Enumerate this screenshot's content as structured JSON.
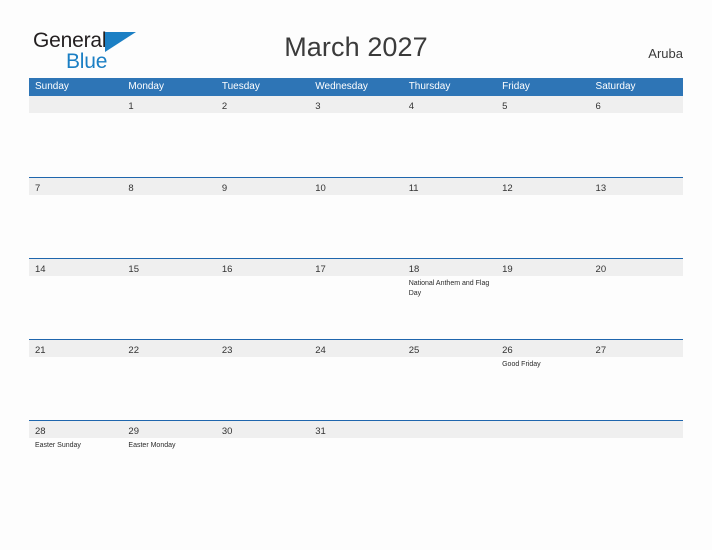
{
  "brand": {
    "name_part1": "General",
    "name_part2": "Blue",
    "flag_color": "#1b7fc4"
  },
  "header": {
    "title": "March 2027",
    "country": "Aruba"
  },
  "theme": {
    "header_blue": "#2e75b6",
    "row_line_blue": "#1f66ad",
    "number_band_gray": "#efefef",
    "page_background": "#fdfdfd"
  },
  "calendar": {
    "day_names": [
      "Sunday",
      "Monday",
      "Tuesday",
      "Wednesday",
      "Thursday",
      "Friday",
      "Saturday"
    ],
    "weeks": [
      [
        {
          "day": "",
          "events": []
        },
        {
          "day": "1",
          "events": []
        },
        {
          "day": "2",
          "events": []
        },
        {
          "day": "3",
          "events": []
        },
        {
          "day": "4",
          "events": []
        },
        {
          "day": "5",
          "events": []
        },
        {
          "day": "6",
          "events": []
        }
      ],
      [
        {
          "day": "7",
          "events": []
        },
        {
          "day": "8",
          "events": []
        },
        {
          "day": "9",
          "events": []
        },
        {
          "day": "10",
          "events": []
        },
        {
          "day": "11",
          "events": []
        },
        {
          "day": "12",
          "events": []
        },
        {
          "day": "13",
          "events": []
        }
      ],
      [
        {
          "day": "14",
          "events": []
        },
        {
          "day": "15",
          "events": []
        },
        {
          "day": "16",
          "events": []
        },
        {
          "day": "17",
          "events": []
        },
        {
          "day": "18",
          "events": [
            "National Anthem and Flag Day"
          ]
        },
        {
          "day": "19",
          "events": []
        },
        {
          "day": "20",
          "events": []
        }
      ],
      [
        {
          "day": "21",
          "events": []
        },
        {
          "day": "22",
          "events": []
        },
        {
          "day": "23",
          "events": []
        },
        {
          "day": "24",
          "events": []
        },
        {
          "day": "25",
          "events": []
        },
        {
          "day": "26",
          "events": [
            "Good Friday"
          ]
        },
        {
          "day": "27",
          "events": []
        }
      ],
      [
        {
          "day": "28",
          "events": [
            "Easter Sunday"
          ]
        },
        {
          "day": "29",
          "events": [
            "Easter Monday"
          ]
        },
        {
          "day": "30",
          "events": []
        },
        {
          "day": "31",
          "events": []
        },
        {
          "day": "",
          "events": []
        },
        {
          "day": "",
          "events": []
        },
        {
          "day": "",
          "events": []
        }
      ]
    ]
  }
}
